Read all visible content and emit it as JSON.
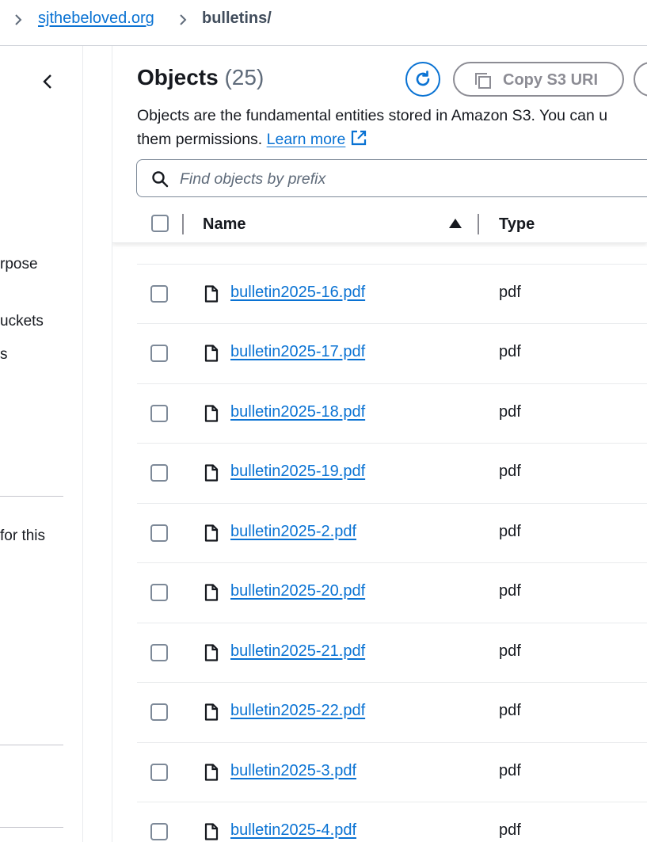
{
  "breadcrumb": {
    "bucket": "sjthebeloved.org",
    "folder": "bulletins/"
  },
  "left_nav": {
    "fragments": [
      "rpose",
      "uckets",
      "s",
      "for this"
    ]
  },
  "objects": {
    "title": "Objects",
    "count": "(25)",
    "copy_uri_label": "Copy S3 URI",
    "description_line1": "Objects are the fundamental entities stored in Amazon S3. You can u",
    "description_line2": "them permissions.",
    "learn_more": "Learn more",
    "search_placeholder": "Find objects by prefix"
  },
  "table": {
    "columns": [
      "Name",
      "Type"
    ],
    "sort": "ascending",
    "rows": [
      {
        "name": "bulletin2025-16.pdf",
        "type": "pdf"
      },
      {
        "name": "bulletin2025-17.pdf",
        "type": "pdf"
      },
      {
        "name": "bulletin2025-18.pdf",
        "type": "pdf"
      },
      {
        "name": "bulletin2025-19.pdf",
        "type": "pdf"
      },
      {
        "name": "bulletin2025-2.pdf",
        "type": "pdf"
      },
      {
        "name": "bulletin2025-20.pdf",
        "type": "pdf"
      },
      {
        "name": "bulletin2025-21.pdf",
        "type": "pdf"
      },
      {
        "name": "bulletin2025-22.pdf",
        "type": "pdf"
      },
      {
        "name": "bulletin2025-3.pdf",
        "type": "pdf"
      },
      {
        "name": "bulletin2025-4.pdf",
        "type": "pdf"
      }
    ]
  },
  "colors": {
    "link": "#0972d3",
    "text": "#16191f",
    "disabled": "#8c8c94"
  }
}
